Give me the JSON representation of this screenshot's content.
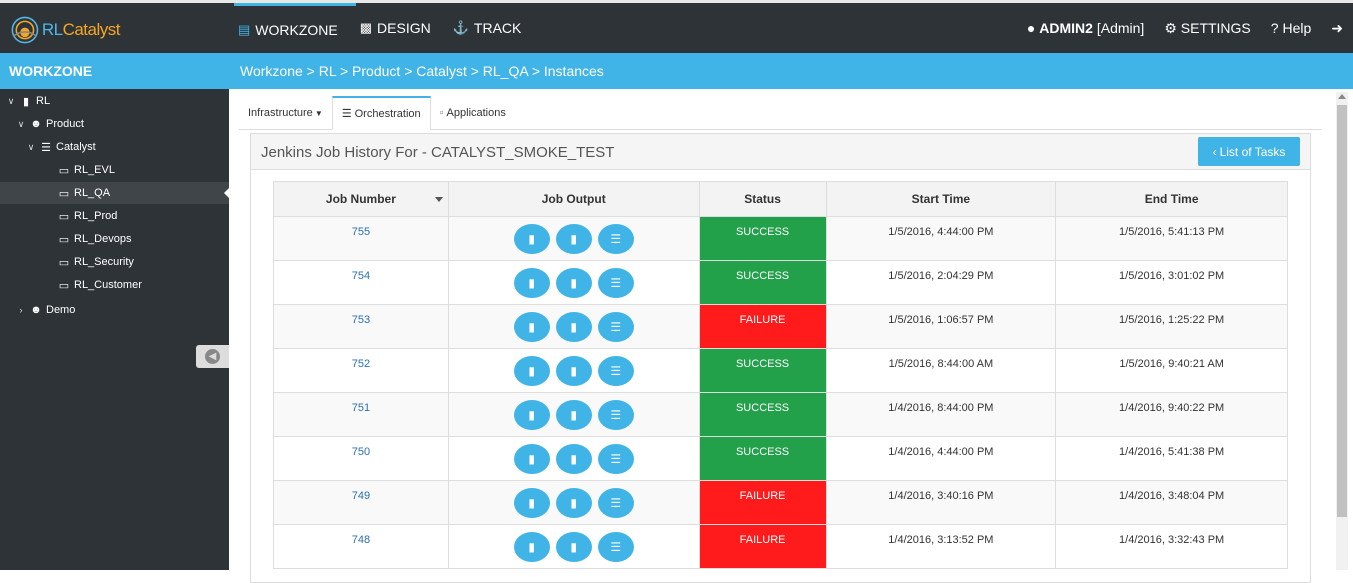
{
  "app": {
    "logo_text_a": "RL",
    "logo_text_b": "Catalyst"
  },
  "nav": [
    {
      "label": "WORKZONE",
      "icon": "monitor-icon"
    },
    {
      "label": "DESIGN",
      "icon": "puzzle-icon"
    },
    {
      "label": "TRACK",
      "icon": "anchor-icon"
    }
  ],
  "topright": {
    "user": "ADMIN2",
    "role": "[Admin]",
    "settings": "SETTINGS",
    "help": "Help"
  },
  "sidebar": {
    "title": "WORKZONE",
    "tree": [
      {
        "label": "RL"
      },
      {
        "label": "Product"
      },
      {
        "label": "Catalyst"
      },
      {
        "label": "RL_EVL"
      },
      {
        "label": "RL_QA"
      },
      {
        "label": "RL_Prod"
      },
      {
        "label": "RL_Devops"
      },
      {
        "label": "RL_Security"
      },
      {
        "label": "RL_Customer"
      },
      {
        "label": "Demo"
      }
    ]
  },
  "breadcrumb": "Workzone > RL > Product > Catalyst > RL_QA > Instances",
  "tabs": [
    {
      "label": "Infrastructure"
    },
    {
      "label": "Orchestration"
    },
    {
      "label": "Applications"
    }
  ],
  "panel": {
    "title": "Jenkins Job History For - CATALYST_SMOKE_TEST",
    "list_button": "List of Tasks"
  },
  "table": {
    "headers": [
      "Job Number",
      "Job Output",
      "Status",
      "Start Time",
      "End Time"
    ],
    "rows": [
      {
        "job": "755",
        "status": "SUCCESS",
        "start": "1/5/2016, 4:44:00 PM",
        "end": "1/5/2016, 5:41:13 PM"
      },
      {
        "job": "754",
        "status": "SUCCESS",
        "start": "1/5/2016, 2:04:29 PM",
        "end": "1/5/2016, 3:01:02 PM"
      },
      {
        "job": "753",
        "status": "FAILURE",
        "start": "1/5/2016, 1:06:57 PM",
        "end": "1/5/2016, 1:25:22 PM"
      },
      {
        "job": "752",
        "status": "SUCCESS",
        "start": "1/5/2016, 8:44:00 AM",
        "end": "1/5/2016, 9:40:21 AM"
      },
      {
        "job": "751",
        "status": "SUCCESS",
        "start": "1/4/2016, 8:44:00 PM",
        "end": "1/4/2016, 9:40:22 PM"
      },
      {
        "job": "750",
        "status": "SUCCESS",
        "start": "1/4/2016, 4:44:00 PM",
        "end": "1/4/2016, 5:41:38 PM"
      },
      {
        "job": "749",
        "status": "FAILURE",
        "start": "1/4/2016, 3:40:16 PM",
        "end": "1/4/2016, 3:48:04 PM"
      },
      {
        "job": "748",
        "status": "FAILURE",
        "start": "1/4/2016, 3:13:52 PM",
        "end": "1/4/2016, 3:32:43 PM"
      }
    ]
  },
  "colors": {
    "accent": "#40b4e6",
    "dark": "#2e3338",
    "success": "#22a04a",
    "failure": "#ff1b1b"
  }
}
